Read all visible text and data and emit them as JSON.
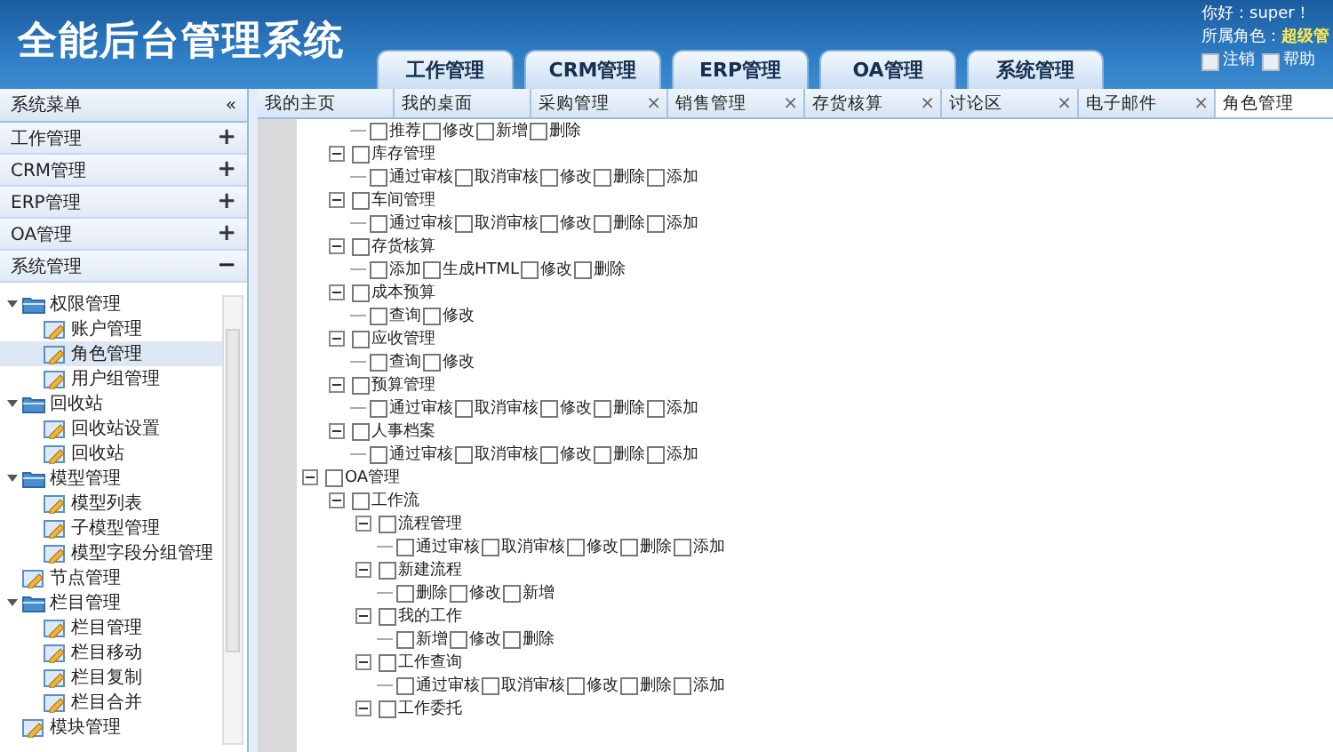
{
  "header": {
    "title": "全能后台管理系统",
    "top_tabs": [
      {
        "label": "工作管理"
      },
      {
        "label": "CRM管理"
      },
      {
        "label": "ERP管理"
      },
      {
        "label": "OA管理"
      },
      {
        "label": "系统管理"
      }
    ],
    "user": {
      "greeting": "你好：super！",
      "role_label": "所属角色：",
      "role": "超级管",
      "logout": "注销",
      "help": "帮助"
    }
  },
  "sidebar": {
    "title": "系统菜单",
    "collapse": "«",
    "sections": [
      {
        "label": "工作管理",
        "expanded": false,
        "toggle": "+"
      },
      {
        "label": "CRM管理",
        "expanded": false,
        "toggle": "+"
      },
      {
        "label": "ERP管理",
        "expanded": false,
        "toggle": "+"
      },
      {
        "label": "OA管理",
        "expanded": false,
        "toggle": "+"
      },
      {
        "label": "系统管理",
        "expanded": true,
        "toggle": "−"
      }
    ],
    "tree": [
      {
        "label": "权限管理",
        "expanded": true,
        "children": [
          {
            "label": "账户管理",
            "selected": false
          },
          {
            "label": "角色管理",
            "selected": true
          },
          {
            "label": "用户组管理",
            "selected": false
          }
        ]
      },
      {
        "label": "回收站",
        "expanded": true,
        "children": [
          {
            "label": "回收站设置",
            "selected": false
          },
          {
            "label": "回收站",
            "selected": false
          }
        ]
      },
      {
        "label": "模型管理",
        "expanded": true,
        "children": [
          {
            "label": "模型列表",
            "selected": false
          },
          {
            "label": "子模型管理",
            "selected": false
          },
          {
            "label": "模型字段分组管理",
            "selected": false
          }
        ]
      },
      {
        "label": "节点管理",
        "selected": false
      },
      {
        "label": "栏目管理",
        "expanded": true,
        "children": [
          {
            "label": "栏目管理",
            "selected": false
          },
          {
            "label": "栏目移动",
            "selected": false
          },
          {
            "label": "栏目复制",
            "selected": false
          },
          {
            "label": "栏目合并",
            "selected": false
          }
        ]
      },
      {
        "label": "模块管理",
        "selected": false
      }
    ]
  },
  "content_tabs": [
    {
      "label": "我的主页",
      "selected": false
    },
    {
      "label": "我的桌面",
      "selected": false
    },
    {
      "label": "采购管理",
      "close": "×",
      "selected": false
    },
    {
      "label": "销售管理",
      "close": "×",
      "selected": false
    },
    {
      "label": "存货核算",
      "close": "×",
      "selected": false
    },
    {
      "label": "讨论区",
      "close": "×",
      "selected": false
    },
    {
      "label": "电子邮件",
      "close": "×",
      "selected": false
    },
    {
      "label": "角色管理",
      "selected": true
    }
  ],
  "permission_tree": {
    "continued_items": [
      {
        "actions": [
          {
            "label": "推荐",
            "checked": false
          },
          {
            "label": "修改",
            "checked": false
          },
          {
            "label": "新增",
            "checked": false
          },
          {
            "label": "删除",
            "checked": false
          }
        ]
      },
      {
        "label": "库存管理",
        "checked": false,
        "actions": [
          {
            "label": "通过审核",
            "checked": false
          },
          {
            "label": "取消审核",
            "checked": false
          },
          {
            "label": "修改",
            "checked": false
          },
          {
            "label": "删除",
            "checked": false
          },
          {
            "label": "添加",
            "checked": false
          }
        ]
      },
      {
        "label": "车间管理",
        "checked": false,
        "actions": [
          {
            "label": "通过审核",
            "checked": false
          },
          {
            "label": "取消审核",
            "checked": false
          },
          {
            "label": "修改",
            "checked": false
          },
          {
            "label": "删除",
            "checked": false
          },
          {
            "label": "添加",
            "checked": false
          }
        ]
      },
      {
        "label": "存货核算",
        "checked": false,
        "actions": [
          {
            "label": "添加",
            "checked": false
          },
          {
            "label": "生成HTML",
            "checked": false
          },
          {
            "label": "修改",
            "checked": false
          },
          {
            "label": "删除",
            "checked": false
          }
        ]
      },
      {
        "label": "成本预算",
        "checked": false,
        "actions": [
          {
            "label": "查询",
            "checked": false
          },
          {
            "label": "修改",
            "checked": false
          }
        ]
      },
      {
        "label": "应收管理",
        "checked": false,
        "actions": [
          {
            "label": "查询",
            "checked": false
          },
          {
            "label": "修改",
            "checked": false
          }
        ]
      },
      {
        "label": "预算管理",
        "checked": false,
        "actions": [
          {
            "label": "通过审核",
            "checked": false
          },
          {
            "label": "取消审核",
            "checked": false
          },
          {
            "label": "修改",
            "checked": false
          },
          {
            "label": "删除",
            "checked": false
          },
          {
            "label": "添加",
            "checked": false
          }
        ]
      },
      {
        "label": "人事档案",
        "checked": false,
        "actions": [
          {
            "label": "通过审核",
            "checked": false
          },
          {
            "label": "取消审核",
            "checked": false
          },
          {
            "label": "修改",
            "checked": false
          },
          {
            "label": "删除",
            "checked": false
          },
          {
            "label": "添加",
            "checked": false
          }
        ]
      }
    ],
    "roots": [
      {
        "label": "OA管理",
        "checked": false,
        "children": [
          {
            "label": "工作流",
            "checked": false,
            "children": [
              {
                "label": "流程管理",
                "checked": false,
                "actions": [
                  {
                    "label": "通过审核",
                    "checked": false
                  },
                  {
                    "label": "取消审核",
                    "checked": false
                  },
                  {
                    "label": "修改",
                    "checked": false
                  },
                  {
                    "label": "删除",
                    "checked": false
                  },
                  {
                    "label": "添加",
                    "checked": false
                  }
                ]
              },
              {
                "label": "新建流程",
                "checked": false,
                "actions": [
                  {
                    "label": "删除",
                    "checked": false
                  },
                  {
                    "label": "修改",
                    "checked": false
                  },
                  {
                    "label": "新增",
                    "checked": false
                  }
                ]
              },
              {
                "label": "我的工作",
                "checked": false,
                "actions": [
                  {
                    "label": "新增",
                    "checked": false
                  },
                  {
                    "label": "修改",
                    "checked": false
                  },
                  {
                    "label": "删除",
                    "checked": false
                  }
                ]
              },
              {
                "label": "工作查询",
                "checked": false,
                "actions": [
                  {
                    "label": "通过审核",
                    "checked": false
                  },
                  {
                    "label": "取消审核",
                    "checked": false
                  },
                  {
                    "label": "修改",
                    "checked": false
                  },
                  {
                    "label": "删除",
                    "checked": false
                  },
                  {
                    "label": "添加",
                    "checked": false
                  }
                ]
              },
              {
                "label": "工作委托",
                "checked": false,
                "expanded": true
              }
            ]
          }
        ]
      }
    ]
  }
}
